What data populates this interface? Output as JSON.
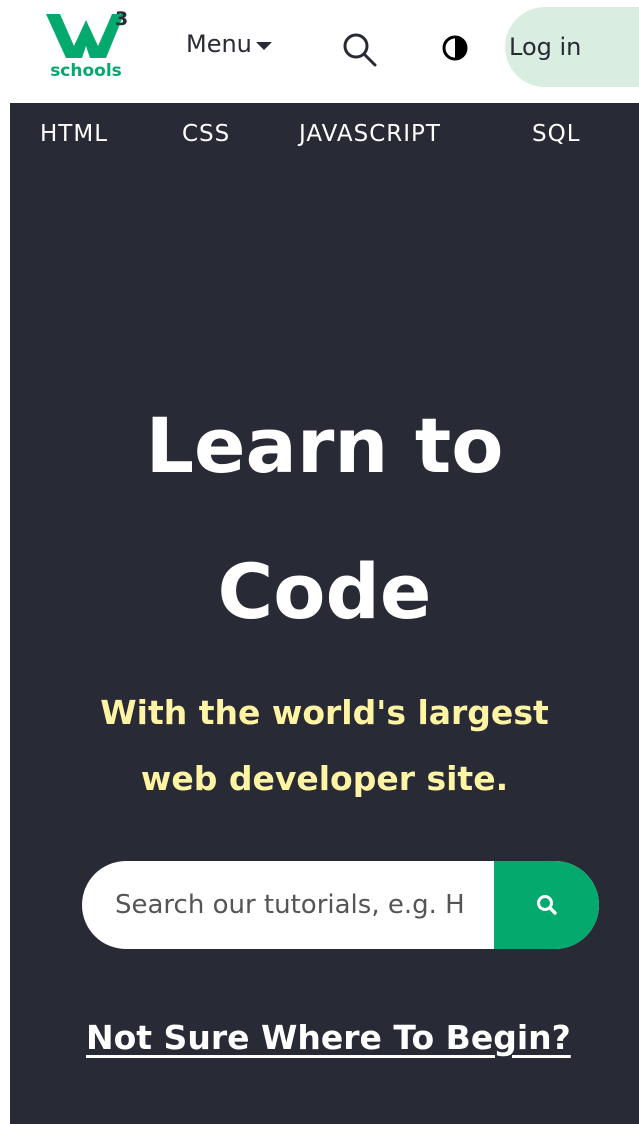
{
  "brand": {
    "logo_text": "schools",
    "logo_sup": "3",
    "accent_color": "#04AA6D",
    "dark_color": "#282A35"
  },
  "topbar": {
    "menu_label": "Menu",
    "search_icon": "search-icon",
    "theme_icon": "contrast-icon",
    "login_label": "Log in"
  },
  "subnav": {
    "items": [
      "HTML",
      "CSS",
      "JAVASCRIPT",
      "SQL"
    ]
  },
  "hero": {
    "title_line1": "Learn to",
    "title_line2": "Code",
    "subtitle_line1": "With the world's largest",
    "subtitle_line2": "web developer site.",
    "subtitle_color": "#FFF4A3",
    "search_placeholder": "Search our tutorials, e.g. H",
    "search_button_icon": "search-icon",
    "not_sure_link": "Not Sure Where To Begin?"
  }
}
